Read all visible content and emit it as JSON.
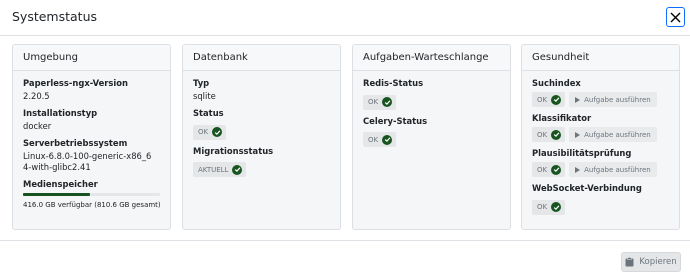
{
  "modal": {
    "title": "Systemstatus"
  },
  "cards": {
    "environment": {
      "title": "Umgebung",
      "version_label": "Paperless-ngx-Version",
      "version_value": "2.20.5",
      "install_label": "Installationstyp",
      "install_value": "docker",
      "os_label": "Serverbetriebssystem",
      "os_value": "Linux-6.8.0-100-generic-x86_64-with-glibc2.41",
      "storage_label": "Medienspeicher",
      "storage_text": "416.0 GB verfügbar (810.6 GB gesamt)",
      "storage_used_fraction": 0.487
    },
    "database": {
      "title": "Datenbank",
      "type_label": "Typ",
      "type_value": "sqlite",
      "status_label": "Status",
      "status_value": "OK",
      "migration_label": "Migrationsstatus",
      "migration_value": "AKTUELL"
    },
    "queue": {
      "title": "Aufgaben-Warteschlange",
      "redis_label": "Redis-Status",
      "redis_value": "OK",
      "celery_label": "Celery-Status",
      "celery_value": "OK"
    },
    "health": {
      "title": "Gesundheit",
      "index_label": "Suchindex",
      "index_value": "OK",
      "classifier_label": "Klassifikator",
      "classifier_value": "OK",
      "sanity_label": "Plausibilitätsprüfung",
      "sanity_value": "OK",
      "websocket_label": "WebSocket-Verbindung",
      "websocket_value": "OK",
      "run_task_label": "Aufgabe ausführen"
    }
  },
  "footer": {
    "copy_label": "Kopieren"
  },
  "colors": {
    "accent": "#0d6efd",
    "success": "#17541f",
    "muted": "#6c757d"
  }
}
